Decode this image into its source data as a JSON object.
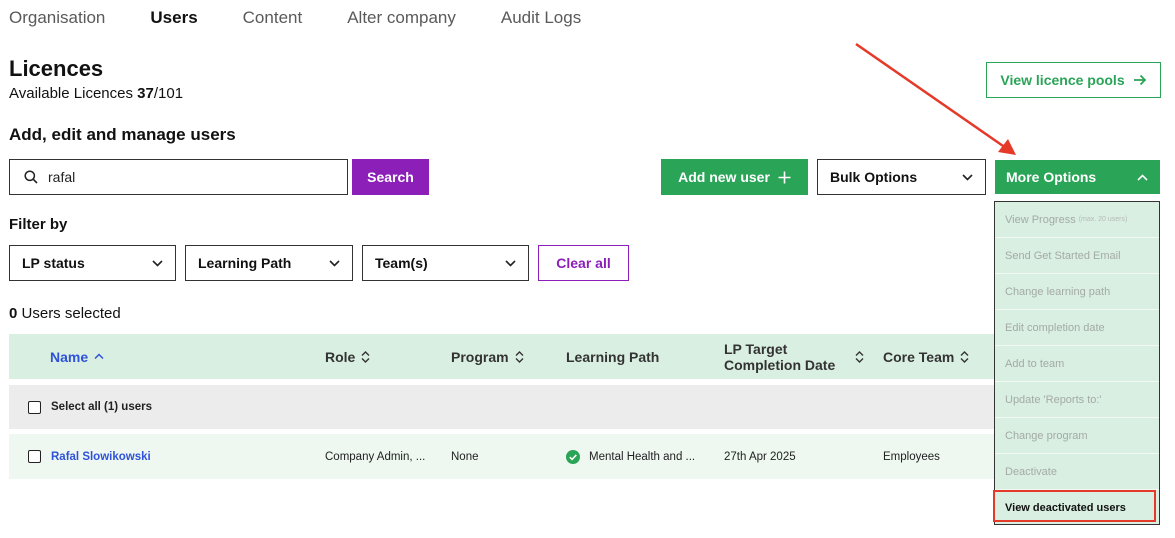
{
  "nav": {
    "tabs": [
      {
        "label": "Organisation",
        "active": false
      },
      {
        "label": "Users",
        "active": true
      },
      {
        "label": "Content",
        "active": false
      },
      {
        "label": "Alter company",
        "active": false
      },
      {
        "label": "Audit Logs",
        "active": false
      }
    ]
  },
  "licences": {
    "title": "Licences",
    "available_label": "Available Licences",
    "available": "37",
    "total": "/101",
    "pools_button": "View licence pools"
  },
  "manage": {
    "title": "Add, edit and manage users",
    "search_value": "rafal",
    "search_button": "Search",
    "add_button": "Add new user",
    "bulk_label": "Bulk Options",
    "more_label": "More Options"
  },
  "filters": {
    "title": "Filter by",
    "lp_status": "LP status",
    "learning_path": "Learning Path",
    "teams": "Team(s)",
    "clear": "Clear all"
  },
  "selection": {
    "count": "0",
    "label": "Users selected"
  },
  "table": {
    "headers": {
      "name": "Name",
      "role": "Role",
      "program": "Program",
      "learning_path": "Learning Path",
      "lp_date": "LP Target Completion Date",
      "core_team": "Core Team"
    },
    "select_all": "Select all (1) users",
    "rows": [
      {
        "name": "Rafal Slowikowski",
        "role": "Company Admin, ...",
        "program": "None",
        "learning_path": "Mental Health and ...",
        "date": "27th Apr 2025",
        "core_team": "Employees"
      }
    ]
  },
  "more_options_menu": {
    "items": [
      {
        "label": "View Progress",
        "note": "(max. 20 users)"
      },
      {
        "label": "Send Get Started Email"
      },
      {
        "label": "Change learning path"
      },
      {
        "label": "Edit completion date"
      },
      {
        "label": "Add to team"
      },
      {
        "label": "Update 'Reports to:'"
      },
      {
        "label": "Change program"
      },
      {
        "label": "Deactivate"
      },
      {
        "label": "View deactivated users"
      }
    ]
  },
  "colors": {
    "green": "#2aa457",
    "purple": "#8b1fb8",
    "link_blue": "#2f52d8",
    "annotation_red": "#e53929",
    "table_header_bg": "#d9efe2"
  }
}
